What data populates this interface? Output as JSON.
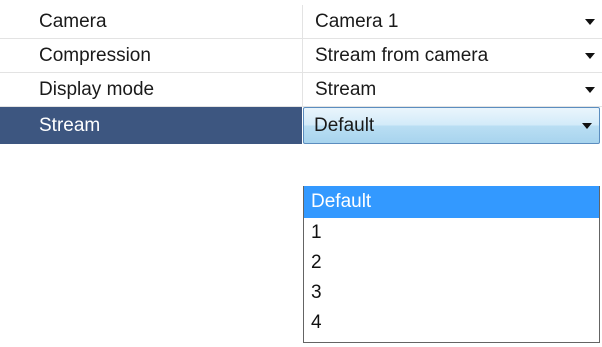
{
  "properties": [
    {
      "label": "Camera",
      "value": "Camera 1"
    },
    {
      "label": "Compression",
      "value": "Stream from camera"
    },
    {
      "label": "Display mode",
      "value": "Stream"
    },
    {
      "label": "Stream",
      "value": "Default"
    }
  ],
  "dropdown": {
    "options": [
      "Default",
      "1",
      "2",
      "3",
      "4"
    ],
    "highlighted": "Default"
  },
  "colors": {
    "selected_label_bg": "#3d5680",
    "highlight_bg": "#3399ff"
  }
}
